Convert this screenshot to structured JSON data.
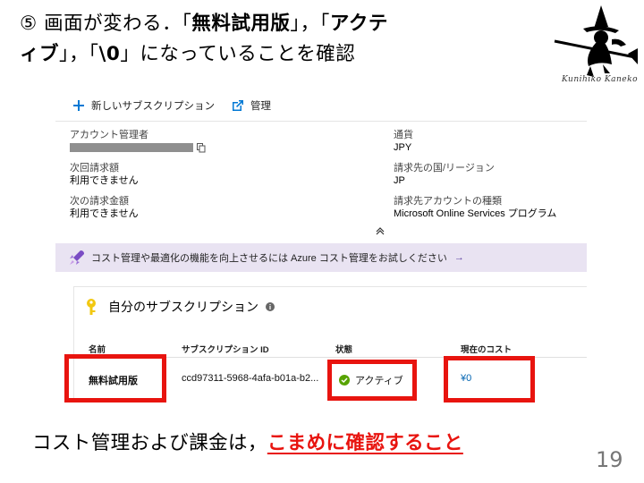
{
  "title": {
    "line1_pre": "⑤ 画面が変わる．「",
    "line1_bold1": "無料試用版",
    "line1_mid": "」，「",
    "line1_bold2": "アクテ",
    "line2_bold": "ィブ",
    "line2_mid1": "」，「",
    "line2_bold3": "\\0",
    "line2_post": "」になっていることを確認"
  },
  "signature": "Kunihiko Kaneko",
  "toolbar": {
    "new_subscription": "新しいサブスクリプション",
    "manage": "管理"
  },
  "details": {
    "account_admin_label": "アカウント管理者",
    "currency_label": "通貨",
    "currency_value": "JPY",
    "next_bill_label": "次回請求額",
    "next_bill_value": "利用できません",
    "bill_to_country_label": "請求先の国/リージョン",
    "bill_to_country_value": "JP",
    "next_charge_label": "次の請求金額",
    "next_charge_value": "利用できません",
    "billing_account_type_label": "請求先アカウントの種類",
    "billing_account_type_value": "Microsoft Online Services プログラム"
  },
  "banner": {
    "text": "コスト管理や最適化の機能を向上させるには Azure コスト管理をお試しください",
    "arrow": "→"
  },
  "panel": {
    "title": "自分のサブスクリプション",
    "columns": [
      "名前",
      "サブスクリプション ID",
      "状態",
      "現在のコスト"
    ],
    "row": {
      "name": "無料試用版",
      "id": "ccd97311-5968-4afa-b01a-b2...",
      "status": "アクティブ",
      "cost": "¥0"
    }
  },
  "footer": {
    "text": "コスト管理および課金は，",
    "emphasis": "こまめに確認すること"
  },
  "page_number": "19",
  "colors": {
    "accent_red": "#e8140f",
    "banner_bg": "#e9e3f2",
    "link_blue": "#0063b1",
    "status_green": "#57a300"
  }
}
